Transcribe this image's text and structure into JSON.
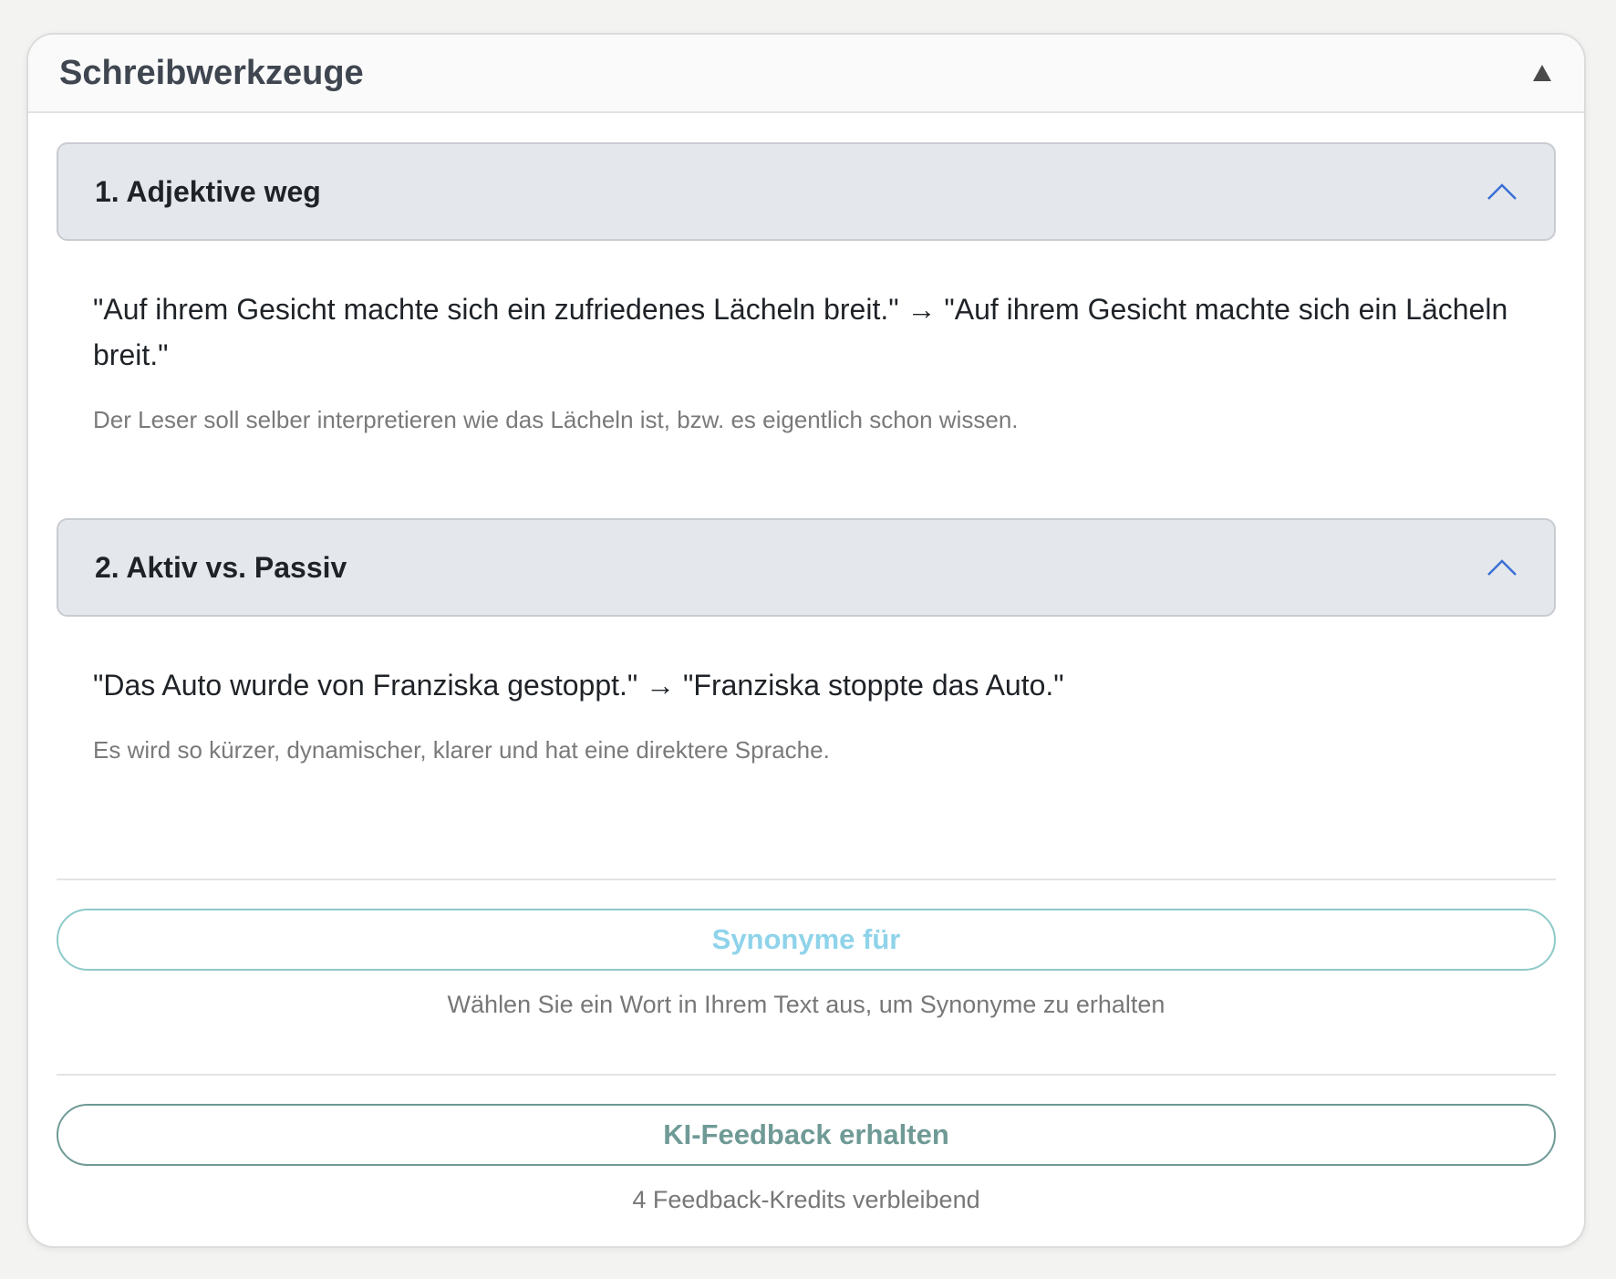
{
  "panel": {
    "title": "Schreibwerkzeuge"
  },
  "sections": [
    {
      "title": "1. Adjektive weg",
      "example": "\"Auf ihrem Gesicht machte sich ein zufriedenes Lächeln breit.\" → \"Auf ihrem Gesicht machte sich ein Lächeln breit.\"",
      "explanation": "Der Leser soll selber interpretieren wie das Lächeln ist, bzw. es eigentlich schon wissen."
    },
    {
      "title": "2. Aktiv vs. Passiv",
      "example": "\"Das Auto wurde von Franziska gestoppt.\" → \"Franziska stoppte das Auto.\"",
      "explanation": "Es wird so kürzer, dynamischer, klarer und hat eine direktere Sprache."
    }
  ],
  "synonyms": {
    "button_label": "Synonyme für",
    "hint": "Wählen Sie ein Wort in Ihrem Text aus, um Synonyme zu erhalten"
  },
  "feedback": {
    "button_label": "KI-Feedback erhalten",
    "credits": "4 Feedback-Kredits verbleibend"
  },
  "icons": {
    "collapse": "triangle-up-icon",
    "accordion": "chevron-up-icon"
  },
  "colors": {
    "accordion_chevron": "#3b6fd6",
    "synonym_button_text": "#8fd3ea",
    "feedback_button_text": "#6f9a96"
  }
}
